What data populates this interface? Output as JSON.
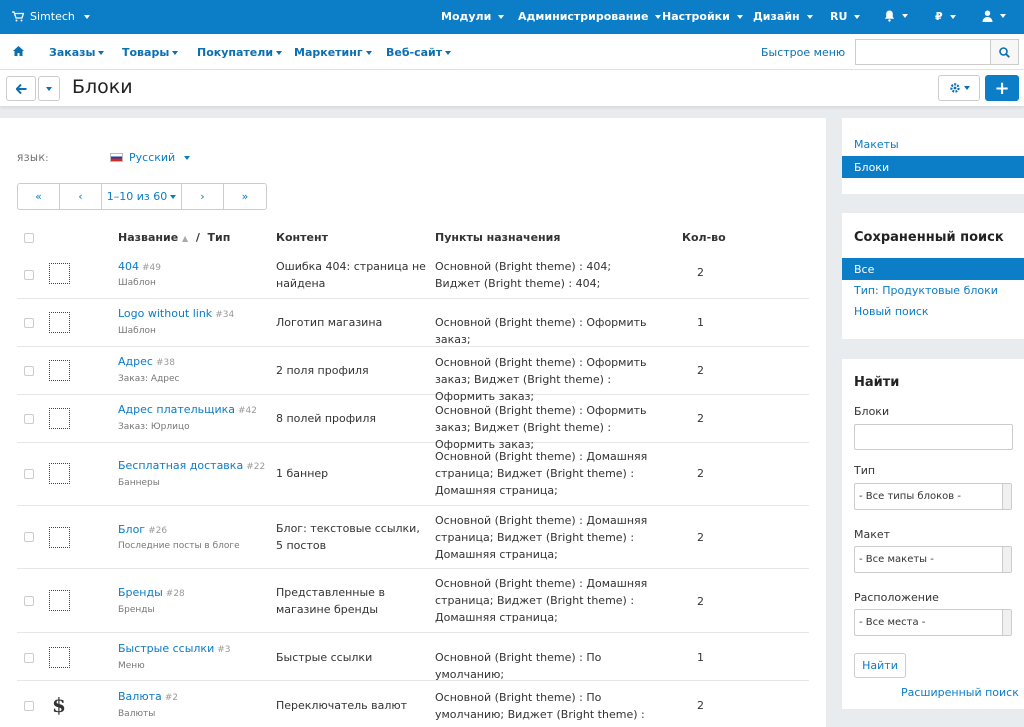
{
  "topbar": {
    "brand": "Simtech",
    "nav": [
      "Модули",
      "Администрирование",
      "Настройки",
      "Дизайн",
      "RU"
    ],
    "currency": "₽"
  },
  "nav2": {
    "items": [
      "Заказы",
      "Товары",
      "Покупатели",
      "Маркетинг",
      "Веб-сайт"
    ],
    "quick_menu": "Быстрое меню",
    "search_placeholder": ""
  },
  "page": {
    "title": "Блоки"
  },
  "language": {
    "label": "ЯЗЫК:",
    "value": "Русский"
  },
  "pager": {
    "first": "«",
    "prev": "‹",
    "range": "1–10 из 60",
    "next": "›",
    "last": "»"
  },
  "table": {
    "headers": {
      "name": "Название",
      "type": "Тип",
      "content": "Контент",
      "destinations": "Пункты назначения",
      "count": "Кол-во"
    },
    "rows": [
      {
        "name": "404",
        "id": "#49",
        "type": "Шаблон",
        "content": "Ошибка 404: страница не найдена",
        "destinations": "Основной (Bright theme) : 404; Виджет (Bright theme) : 404;",
        "count": "2",
        "icon": "dotted-box"
      },
      {
        "name": "Logo without link",
        "id": "#34",
        "type": "Шаблон",
        "content": "Логотип магазина",
        "destinations": "Основной (Bright theme) : Оформить заказ;",
        "count": "1",
        "icon": "dotted-box"
      },
      {
        "name": "Адрес",
        "id": "#38",
        "type": "Заказ: Адрес",
        "content": "2 поля профиля",
        "destinations": "Основной (Bright theme) : Оформить заказ; Виджет (Bright theme) : Оформить заказ;",
        "count": "2",
        "icon": "dotted-box"
      },
      {
        "name": "Адрес плательщика",
        "id": "#42",
        "type": "Заказ: Юрлицо",
        "content": "8 полей профиля",
        "destinations": "Основной (Bright theme) : Оформить заказ; Виджет (Bright theme) : Оформить заказ;",
        "count": "2",
        "icon": "dotted-box"
      },
      {
        "name": "Бесплатная доставка",
        "id": "#22",
        "type": "Баннеры",
        "content": "1 баннер",
        "destinations": "Основной (Bright theme) : Домашняя страница; Виджет (Bright theme) : Домашняя страница;",
        "count": "2",
        "icon": "dotted-box"
      },
      {
        "name": "Блог",
        "id": "#26",
        "type": "Последние посты в блоге",
        "content": "Блог: текстовые ссылки, 5 постов",
        "destinations": "Основной (Bright theme) : Домашняя страница; Виджет (Bright theme) : Домашняя страница;",
        "count": "2",
        "icon": "dotted-box"
      },
      {
        "name": "Бренды",
        "id": "#28",
        "type": "Бренды",
        "content": "Представленные в магазине бренды",
        "destinations": "Основной (Bright theme) : Домашняя страница; Виджет (Bright theme) : Домашняя страница;",
        "count": "2",
        "icon": "dotted-box"
      },
      {
        "name": "Быстрые ссылки",
        "id": "#3",
        "type": "Меню",
        "content": "Быстрые ссылки",
        "destinations": "Основной (Bright theme) : По умолчанию;",
        "count": "1",
        "icon": "dotted-box"
      },
      {
        "name": "Валюта",
        "id": "#2",
        "type": "Валюты",
        "content": "Переключатель валют",
        "destinations": "Основной (Bright theme) : По умолчанию; Виджет (Bright theme) : По умолчанию;",
        "count": "2",
        "icon": "dollar"
      }
    ]
  },
  "sidebar": {
    "links": [
      "Макеты",
      "Блоки"
    ],
    "saved_search": {
      "title": "Сохраненный поиск",
      "items": [
        "Все",
        "Тип: Продуктовые блоки",
        "Новый поиск"
      ]
    },
    "find": {
      "title": "Найти",
      "blocks_label": "Блоки",
      "type_label": "Тип",
      "type_value": "- Все типы блоков -",
      "layout_label": "Макет",
      "layout_value": "- Все макеты -",
      "location_label": "Расположение",
      "location_value": "- Все места -",
      "button": "Найти",
      "advanced": "Расширенный поиск"
    }
  }
}
